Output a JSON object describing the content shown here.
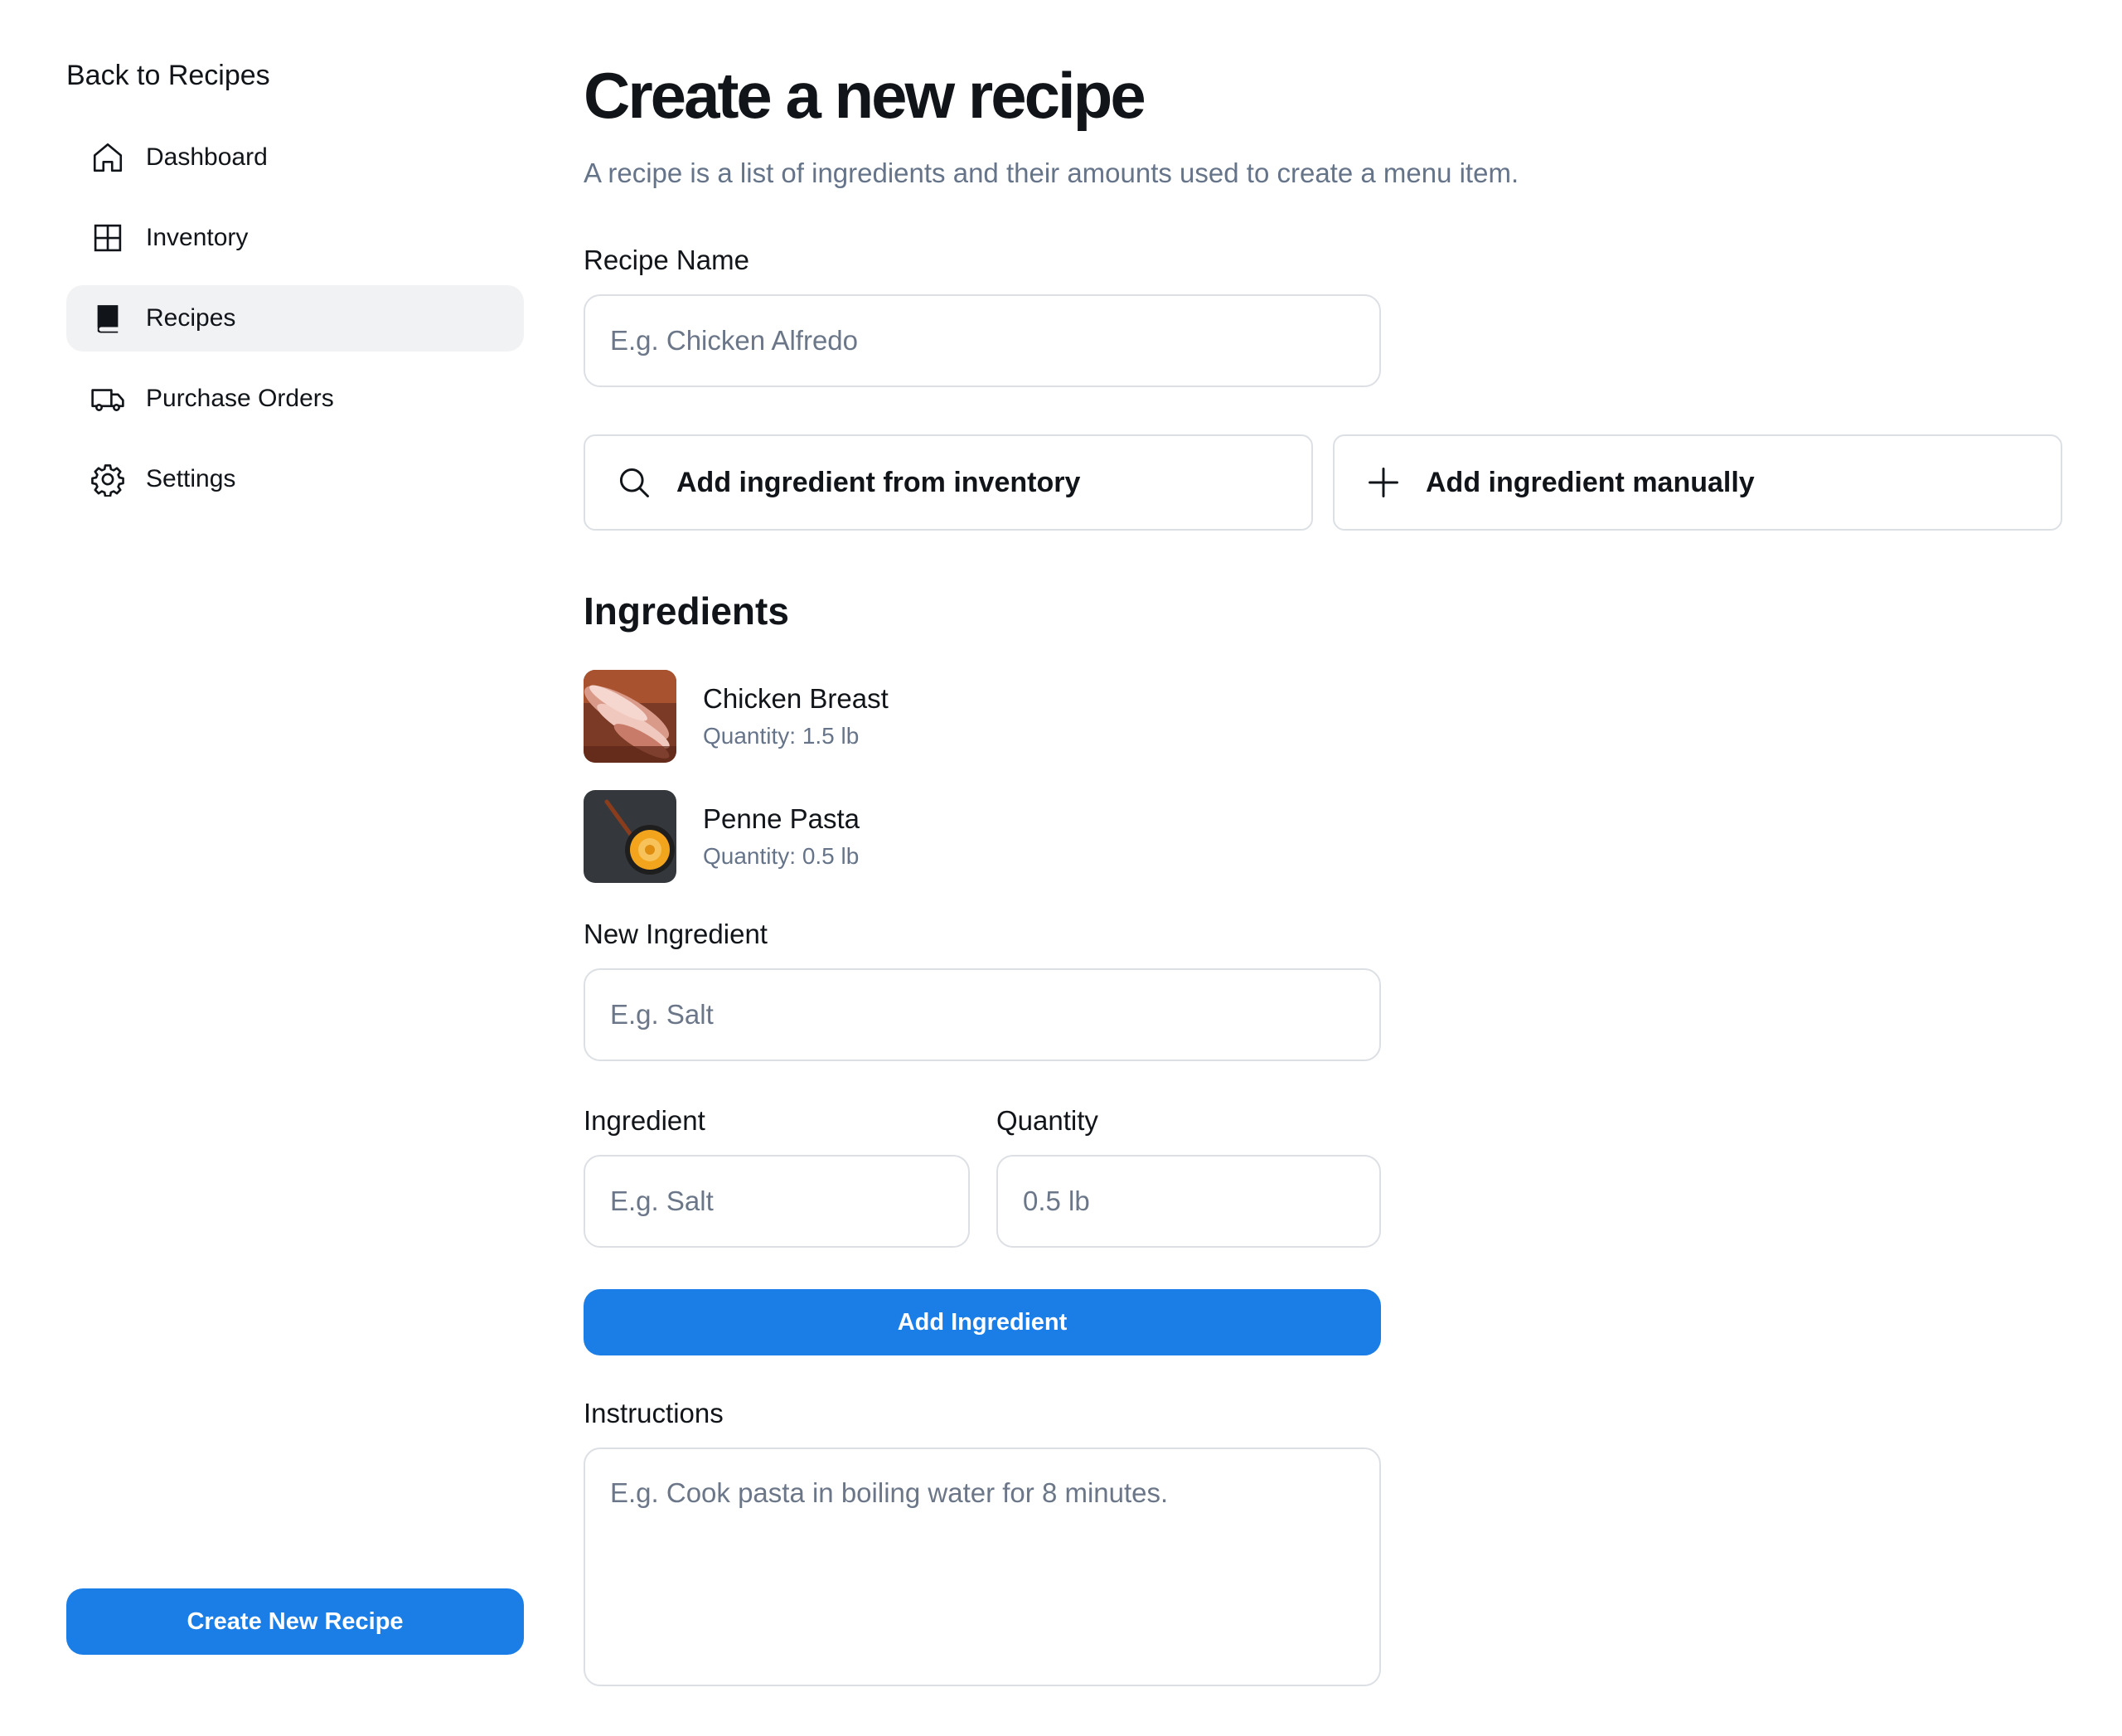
{
  "sidebar": {
    "back_label": "Back to Recipes",
    "items": [
      {
        "label": "Dashboard",
        "icon": "home-icon",
        "active": false
      },
      {
        "label": "Inventory",
        "icon": "grid-icon",
        "active": false
      },
      {
        "label": "Recipes",
        "icon": "book-icon",
        "active": true
      },
      {
        "label": "Purchase Orders",
        "icon": "truck-icon",
        "active": false
      },
      {
        "label": "Settings",
        "icon": "gear-icon",
        "active": false
      }
    ],
    "create_label": "Create New Recipe"
  },
  "main": {
    "title": "Create a new recipe",
    "subtitle": "A recipe is a list of ingredients and their amounts used to create a menu item.",
    "recipe_name": {
      "label": "Recipe Name",
      "placeholder": "E.g. Chicken Alfredo",
      "value": ""
    },
    "actions": {
      "from_inventory": "Add ingredient from inventory",
      "manually": "Add ingredient manually"
    },
    "ingredients_title": "Ingredients",
    "ingredients": [
      {
        "name": "Chicken Breast",
        "quantity": "Quantity: 1.5 lb"
      },
      {
        "name": "Penne Pasta",
        "quantity": "Quantity: 0.5 lb"
      }
    ],
    "new_ingredient": {
      "label": "New Ingredient",
      "placeholder": "E.g. Salt",
      "value": ""
    },
    "ingredient_field": {
      "label": "Ingredient",
      "placeholder": "E.g. Salt",
      "value": ""
    },
    "quantity_field": {
      "label": "Quantity",
      "placeholder": "0.5 lb",
      "value": ""
    },
    "add_ingredient_label": "Add Ingredient",
    "instructions": {
      "label": "Instructions",
      "placeholder": "E.g. Cook pasta in boiling water for 8 minutes.",
      "value": ""
    }
  },
  "colors": {
    "accent": "#1b7ee6",
    "muted_text": "#66748a",
    "border": "#dcdfe4",
    "active_nav_bg": "#f1f2f4"
  }
}
